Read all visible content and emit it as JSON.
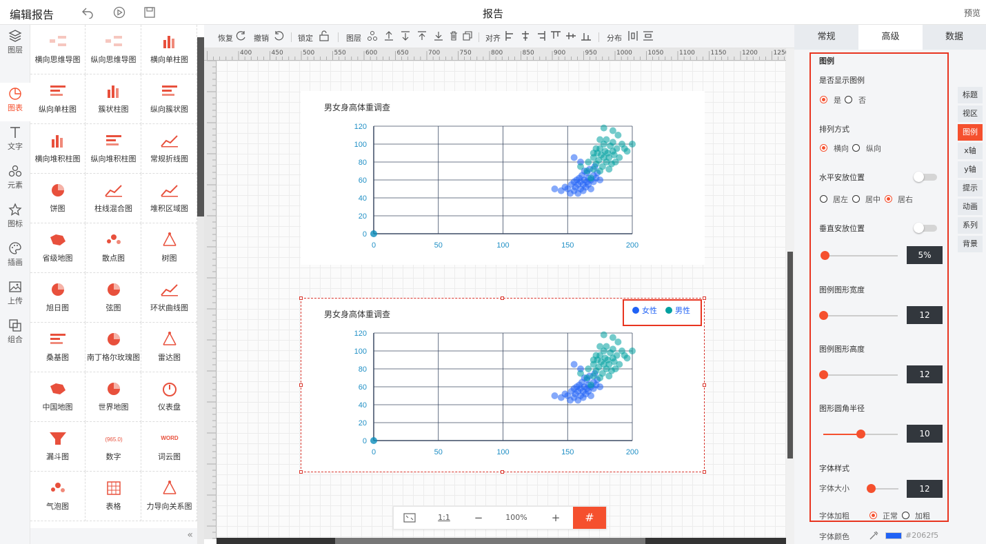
{
  "header": {
    "app_title": "编辑报告",
    "page_title": "报告",
    "preview_label": "预览"
  },
  "leftbar": {
    "items": [
      {
        "key": "layers",
        "label": "图层",
        "icon": "layers-icon"
      },
      {
        "key": "charts",
        "label": "图表",
        "icon": "chart-icon"
      },
      {
        "key": "text",
        "label": "文字",
        "icon": "text-icon"
      },
      {
        "key": "elements",
        "label": "元素",
        "icon": "elements-icon"
      },
      {
        "key": "icons",
        "label": "图标",
        "icon": "star-icon"
      },
      {
        "key": "illustrations",
        "label": "插画",
        "icon": "palette-icon"
      },
      {
        "key": "upload",
        "label": "上传",
        "icon": "image-upload-icon"
      },
      {
        "key": "group",
        "label": "组合",
        "icon": "group-icon"
      }
    ]
  },
  "palette": {
    "items": [
      {
        "label": "横向思维导图",
        "icon": "mindmap-h-icon"
      },
      {
        "label": "纵向思维导图",
        "icon": "mindmap-v-icon"
      },
      {
        "label": "横向单柱图",
        "icon": "bar-chart-icon"
      },
      {
        "label": "纵向单柱图",
        "icon": "hbar-chart-icon"
      },
      {
        "label": "簇状柱图",
        "icon": "cluster-bar-icon"
      },
      {
        "label": "纵向簇状图",
        "icon": "hcluster-bar-icon"
      },
      {
        "label": "横向堆积柱图",
        "icon": "stack-bar-icon"
      },
      {
        "label": "纵向堆积柱图",
        "icon": "hstack-bar-icon"
      },
      {
        "label": "常规折线图",
        "icon": "line-chart-icon"
      },
      {
        "label": "饼图",
        "icon": "pie-chart-icon"
      },
      {
        "label": "柱线混合图",
        "icon": "combo-chart-icon"
      },
      {
        "label": "堆积区域图",
        "icon": "area-chart-icon"
      },
      {
        "label": "省级地图",
        "icon": "province-map-icon"
      },
      {
        "label": "散点图",
        "icon": "scatter-icon"
      },
      {
        "label": "树图",
        "icon": "tree-icon"
      },
      {
        "label": "旭日图",
        "icon": "sunburst-icon"
      },
      {
        "label": "弦图",
        "icon": "chord-icon"
      },
      {
        "label": "环状曲线图",
        "icon": "radial-line-icon"
      },
      {
        "label": "桑基图",
        "icon": "sankey-icon"
      },
      {
        "label": "南丁格尔玫瑰图",
        "icon": "rose-icon"
      },
      {
        "label": "雷达图",
        "icon": "radar-icon"
      },
      {
        "label": "中国地图",
        "icon": "china-map-icon"
      },
      {
        "label": "世界地图",
        "icon": "globe-icon"
      },
      {
        "label": "仪表盘",
        "icon": "gauge-icon"
      },
      {
        "label": "漏斗图",
        "icon": "funnel-icon"
      },
      {
        "label": "数字",
        "icon": "number-icon"
      },
      {
        "label": "词云图",
        "icon": "wordcloud-icon"
      },
      {
        "label": "气泡图",
        "icon": "bubble-icon"
      },
      {
        "label": "表格",
        "icon": "table-icon"
      },
      {
        "label": "力导向关系图",
        "icon": "force-graph-icon"
      }
    ],
    "number_sample": "965.0",
    "wordcloud_sample": "WORD"
  },
  "toolbar": {
    "redo": "恢复",
    "undo": "撤销",
    "lock": "锁定",
    "layer": "图层",
    "align": "对齐",
    "distribute": "分布"
  },
  "ruler": {
    "labels": [
      "400",
      "450",
      "500",
      "550",
      "600",
      "650",
      "700",
      "750",
      "800",
      "850",
      "900",
      "950",
      "1000",
      "1050",
      "1100",
      "1150",
      "1200",
      "1250"
    ]
  },
  "zoom": {
    "fit_label": "1:1",
    "minus": "−",
    "value": "100%",
    "plus": "+"
  },
  "chart_data": [
    {
      "type": "scatter",
      "title": "男女身高体重调查",
      "xlim": [
        0,
        200
      ],
      "ylim": [
        0,
        120
      ],
      "xticks": [
        0,
        50,
        100,
        150,
        200
      ],
      "yticks": [
        0,
        20,
        40,
        60,
        80,
        100,
        120
      ],
      "legend_visible": false,
      "series": [
        {
          "name": "女性",
          "color": "#2062f5",
          "points": [
            [
              0,
              0
            ],
            [
              140,
              50
            ],
            [
              145,
              48
            ],
            [
              148,
              52
            ],
            [
              150,
              50
            ],
            [
              152,
              45
            ],
            [
              153,
              55
            ],
            [
              155,
              48
            ],
            [
              155,
              58
            ],
            [
              156,
              52
            ],
            [
              157,
              60
            ],
            [
              158,
              45
            ],
            [
              158,
              55
            ],
            [
              159,
              62
            ],
            [
              160,
              50
            ],
            [
              160,
              58
            ],
            [
              161,
              65
            ],
            [
              162,
              55
            ],
            [
              162,
              48
            ],
            [
              163,
              60
            ],
            [
              163,
              70
            ],
            [
              164,
              52
            ],
            [
              165,
              58
            ],
            [
              165,
              68
            ],
            [
              166,
              62
            ],
            [
              166,
              55
            ],
            [
              167,
              72
            ],
            [
              168,
              60
            ],
            [
              168,
              50
            ],
            [
              170,
              65
            ],
            [
              170,
              58
            ],
            [
              171,
              75
            ],
            [
              172,
              62
            ],
            [
              173,
              68
            ],
            [
              175,
              60
            ],
            [
              155,
              85
            ],
            [
              160,
              80
            ]
          ]
        },
        {
          "name": "男性",
          "color": "#00a0a0",
          "points": [
            [
              0,
              0
            ],
            [
              160,
              75
            ],
            [
              165,
              70
            ],
            [
              166,
              80
            ],
            [
              168,
              62
            ],
            [
              170,
              72
            ],
            [
              170,
              85
            ],
            [
              172,
              78
            ],
            [
              173,
              90
            ],
            [
              174,
              82
            ],
            [
              175,
              70
            ],
            [
              175,
              95
            ],
            [
              176,
              88
            ],
            [
              177,
              75
            ],
            [
              178,
              100
            ],
            [
              178,
              85
            ],
            [
              179,
              92
            ],
            [
              180,
              80
            ],
            [
              180,
              105
            ],
            [
              181,
              90
            ],
            [
              182,
              85
            ],
            [
              183,
              98
            ],
            [
              184,
              78
            ],
            [
              185,
              92
            ],
            [
              185,
              102
            ],
            [
              186,
              88
            ],
            [
              188,
              95
            ],
            [
              189,
              110
            ],
            [
              190,
              85
            ],
            [
              192,
              100
            ],
            [
              194,
              95
            ],
            [
              196,
              92
            ],
            [
              200,
              100
            ],
            [
              178,
              118
            ],
            [
              185,
              115
            ],
            [
              170,
              90
            ],
            [
              175,
              105
            ],
            [
              182,
              72
            ],
            [
              187,
              80
            ],
            [
              172,
              95
            ]
          ]
        }
      ]
    },
    {
      "type": "scatter",
      "title": "男女身高体重调查",
      "xlim": [
        0,
        200
      ],
      "ylim": [
        0,
        120
      ],
      "xticks": [
        0,
        50,
        100,
        150,
        200
      ],
      "yticks": [
        0,
        20,
        40,
        60,
        80,
        100,
        120
      ],
      "legend_visible": true,
      "legend": [
        "女性",
        "男性"
      ],
      "series": [
        {
          "name": "女性",
          "color": "#2062f5",
          "points": [
            [
              0,
              0
            ],
            [
              140,
              50
            ],
            [
              145,
              48
            ],
            [
              148,
              52
            ],
            [
              150,
              50
            ],
            [
              152,
              45
            ],
            [
              153,
              55
            ],
            [
              155,
              48
            ],
            [
              155,
              58
            ],
            [
              156,
              52
            ],
            [
              157,
              60
            ],
            [
              158,
              45
            ],
            [
              158,
              55
            ],
            [
              159,
              62
            ],
            [
              160,
              50
            ],
            [
              160,
              58
            ],
            [
              161,
              65
            ],
            [
              162,
              55
            ],
            [
              162,
              48
            ],
            [
              163,
              60
            ],
            [
              163,
              70
            ],
            [
              164,
              52
            ],
            [
              165,
              58
            ],
            [
              165,
              68
            ],
            [
              166,
              62
            ],
            [
              166,
              55
            ],
            [
              167,
              72
            ],
            [
              168,
              60
            ],
            [
              168,
              50
            ],
            [
              170,
              65
            ],
            [
              170,
              58
            ],
            [
              171,
              75
            ],
            [
              172,
              62
            ],
            [
              173,
              68
            ],
            [
              175,
              60
            ],
            [
              155,
              85
            ],
            [
              160,
              80
            ]
          ]
        },
        {
          "name": "男性",
          "color": "#00a0a0",
          "points": [
            [
              0,
              0
            ],
            [
              160,
              75
            ],
            [
              165,
              70
            ],
            [
              166,
              80
            ],
            [
              168,
              62
            ],
            [
              170,
              72
            ],
            [
              170,
              85
            ],
            [
              172,
              78
            ],
            [
              173,
              90
            ],
            [
              174,
              82
            ],
            [
              175,
              70
            ],
            [
              175,
              95
            ],
            [
              176,
              88
            ],
            [
              177,
              75
            ],
            [
              178,
              100
            ],
            [
              178,
              85
            ],
            [
              179,
              92
            ],
            [
              180,
              80
            ],
            [
              180,
              105
            ],
            [
              181,
              90
            ],
            [
              182,
              85
            ],
            [
              183,
              98
            ],
            [
              184,
              78
            ],
            [
              185,
              92
            ],
            [
              185,
              102
            ],
            [
              186,
              88
            ],
            [
              188,
              95
            ],
            [
              189,
              110
            ],
            [
              190,
              85
            ],
            [
              192,
              100
            ],
            [
              194,
              95
            ],
            [
              196,
              92
            ],
            [
              200,
              100
            ],
            [
              178,
              118
            ],
            [
              185,
              115
            ],
            [
              170,
              90
            ],
            [
              175,
              105
            ],
            [
              182,
              72
            ],
            [
              187,
              80
            ],
            [
              172,
              95
            ]
          ]
        }
      ]
    }
  ],
  "right_panel": {
    "tabs": [
      "常规",
      "高级",
      "数据"
    ],
    "active_tab": "高级",
    "side_tabs": [
      "标题",
      "视区",
      "图例",
      "x轴",
      "y轴",
      "提示",
      "动画",
      "系列",
      "背景"
    ],
    "active_side_tab": "图例",
    "section_title": "图例",
    "show_legend": {
      "label": "是否显示图例",
      "yes": "是",
      "no": "否",
      "value": "是"
    },
    "orient": {
      "label": "排列方式",
      "h": "横向",
      "v": "纵向",
      "value": "横向"
    },
    "h_pos": {
      "label": "水平安放位置",
      "left": "居左",
      "center": "居中",
      "right": "居右",
      "value": "居右"
    },
    "v_pos": {
      "label": "垂直安放位置",
      "value": "5%",
      "slider_fraction": 0.02
    },
    "width": {
      "label": "图例图形宽度",
      "value": "12",
      "slider_fraction": 0.0
    },
    "height": {
      "label": "图例图形高度",
      "value": "12",
      "slider_fraction": 0.0
    },
    "radius": {
      "label": "图形圆角半径",
      "value": "10",
      "slider_fraction": 0.5
    },
    "font_style": {
      "label": "字体样式",
      "size_label": "字体大小",
      "size_value": "12",
      "size_fraction": 0.1
    },
    "font_weight": {
      "label": "字体加粗",
      "normal": "正常",
      "bold": "加粗",
      "value": "正常"
    },
    "font_color": {
      "label": "字体颜色",
      "value": "#2062f5"
    }
  }
}
